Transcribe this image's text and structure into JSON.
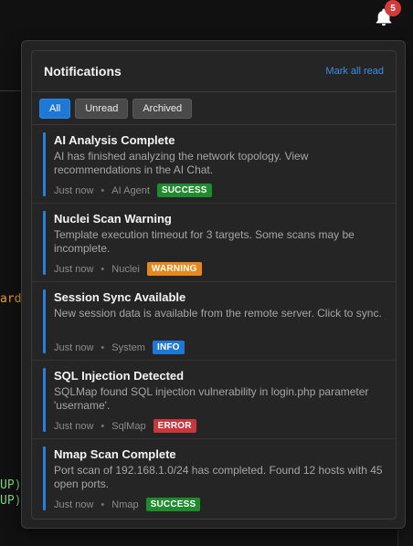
{
  "background": {
    "orange_fragment": "ard",
    "green_fragment_1": "UP)",
    "green_fragment_2": "UP)"
  },
  "bell": {
    "icon": "bell-icon",
    "count": "5"
  },
  "panel": {
    "title": "Notifications",
    "mark_all_read": "Mark all read",
    "tabs": [
      {
        "label": "All",
        "active": true
      },
      {
        "label": "Unread",
        "active": false
      },
      {
        "label": "Archived",
        "active": false
      }
    ]
  },
  "notifications": [
    {
      "title": "AI Analysis Complete",
      "message": "AI has finished analyzing the network topology. View recommendations in the AI Chat.",
      "time": "Just now",
      "source": "AI Agent",
      "status": "SUCCESS",
      "status_color": "#1f8a2e"
    },
    {
      "title": "Nuclei Scan Warning",
      "message": "Template execution timeout for 3 targets. Some scans may be incomplete.",
      "time": "Just now",
      "source": "Nuclei",
      "status": "WARNING",
      "status_color": "#e8871e"
    },
    {
      "title": "Session Sync Available",
      "message": "New session data is available from the remote server. Click to sync.",
      "time": "Just now",
      "source": "System",
      "status": "INFO",
      "status_color": "#1e78d6"
    },
    {
      "title": "SQL Injection Detected",
      "message": "SQLMap found SQL injection vulnerability in login.php parameter 'username'.",
      "time": "Just now",
      "source": "SqlMap",
      "status": "ERROR",
      "status_color": "#c9363b"
    },
    {
      "title": "Nmap Scan Complete",
      "message": "Port scan of 192.168.1.0/24 has completed. Found 12 hosts with 45 open ports.",
      "time": "Just now",
      "source": "Nmap",
      "status": "SUCCESS",
      "status_color": "#1f8a2e"
    }
  ],
  "colors": {
    "accent": "#1e78d6",
    "item_bar": "#2a7fd8",
    "badge": "#d23b3b"
  }
}
